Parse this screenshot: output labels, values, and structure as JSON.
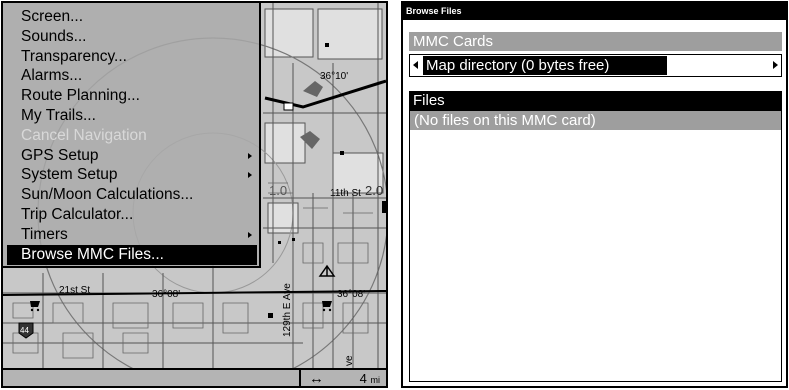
{
  "left": {
    "menu": {
      "items": [
        {
          "label": "Screen...",
          "state": "normal",
          "submenu": false
        },
        {
          "label": "Sounds...",
          "state": "normal",
          "submenu": false
        },
        {
          "label": "Transparency...",
          "state": "normal",
          "submenu": false
        },
        {
          "label": "Alarms...",
          "state": "normal",
          "submenu": false
        },
        {
          "label": "Route Planning...",
          "state": "normal",
          "submenu": false
        },
        {
          "label": "My Trails...",
          "state": "normal",
          "submenu": false
        },
        {
          "label": "Cancel Navigation",
          "state": "disabled",
          "submenu": false
        },
        {
          "label": "GPS Setup",
          "state": "normal",
          "submenu": true
        },
        {
          "label": "System Setup",
          "state": "normal",
          "submenu": true
        },
        {
          "label": "Sun/Moon Calculations...",
          "state": "normal",
          "submenu": false
        },
        {
          "label": "Trip Calculator...",
          "state": "normal",
          "submenu": false
        },
        {
          "label": "Timers",
          "state": "normal",
          "submenu": true
        },
        {
          "label": "Browse MMC Files...",
          "state": "selected",
          "submenu": false
        }
      ]
    },
    "map": {
      "labels": {
        "lat_top": "36°10'",
        "street_11th": "11th St",
        "street_21st": "21st St",
        "ring_10": "1.0",
        "ring_20": "2.0",
        "lat_mid": "36°08'",
        "lat_right": "36°08'",
        "street_129th": "129th E Ave",
        "ave": "ve",
        "route_44": "44"
      }
    },
    "status": {
      "scale_icon": "↔",
      "scale_value": "4",
      "scale_unit": "mi"
    }
  },
  "right": {
    "title": "Browse Files",
    "mmc_header": "MMC Cards",
    "directory": "Map directory  (0 bytes free)",
    "files_header": "Files",
    "files_empty": "(No files on this MMC card)"
  },
  "colors": {
    "menu_bg": "#aaaaaa",
    "map_bg": "#c8c8c8",
    "header_grey": "#9e9e9e",
    "selection": "#000000"
  }
}
